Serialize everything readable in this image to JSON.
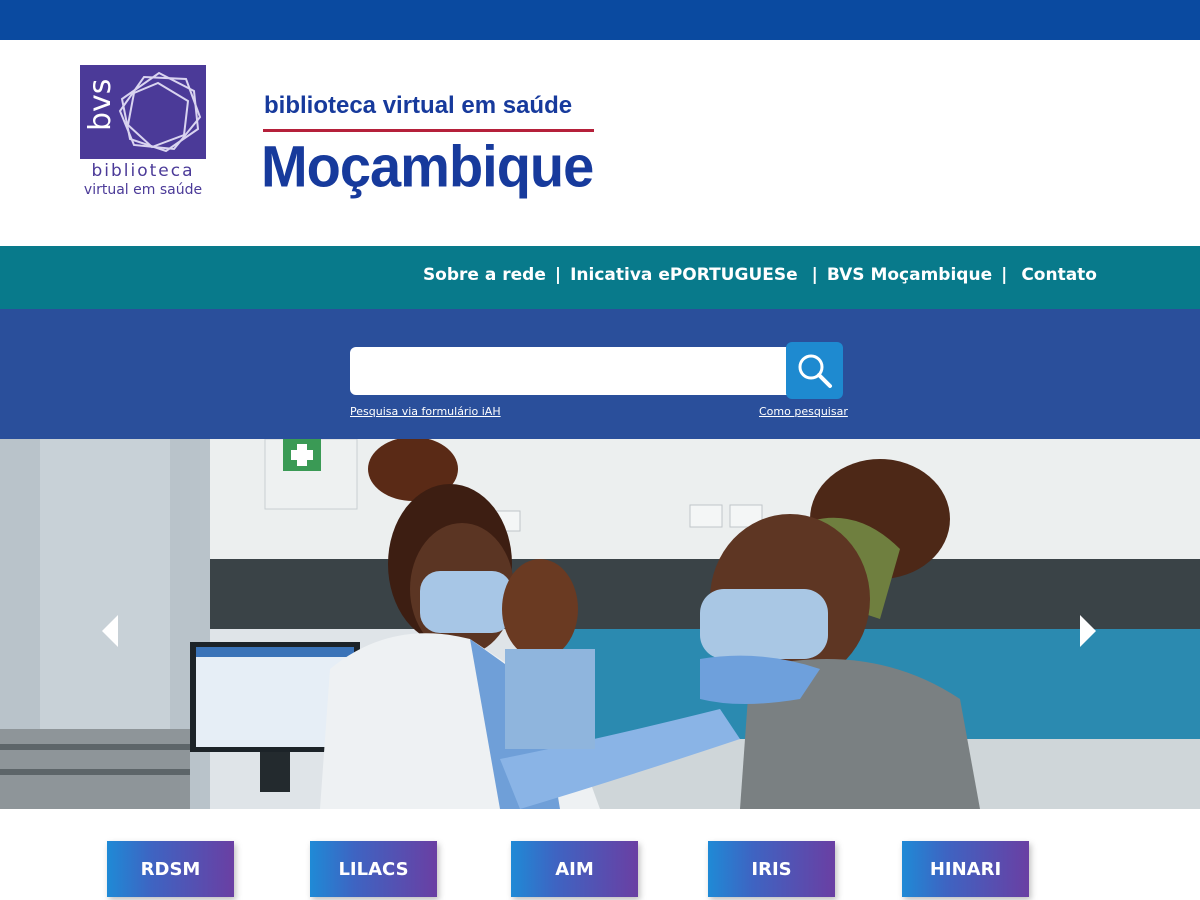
{
  "logo": {
    "abbr": "bvs",
    "line1": "biblioteca",
    "line2": "virtual em saúde"
  },
  "title": {
    "subtitle": "biblioteca virtual em saúde",
    "main": "Moçambique"
  },
  "nav": {
    "items": [
      {
        "label": "Sobre a rede"
      },
      {
        "label": "Inicativa ePORTUGUESe"
      },
      {
        "label": "BVS Moçambique"
      },
      {
        "label": "Contato"
      }
    ],
    "separator": "|"
  },
  "search": {
    "value": "",
    "placeholder": "",
    "link_iah": "Pesquisa via formulário iAH",
    "link_how": "Como pesquisar",
    "icon": "search-icon"
  },
  "hero": {
    "prev_icon": "chevron-left-icon",
    "next_icon": "chevron-right-icon"
  },
  "cards": [
    {
      "label": "RDSM"
    },
    {
      "label": "LILACS"
    },
    {
      "label": "AIM"
    },
    {
      "label": "IRIS"
    },
    {
      "label": "HINARI"
    }
  ],
  "colors": {
    "topbar": "#0a4aa0",
    "nav": "#087a8b",
    "search_band": "#2a4f9b",
    "search_button": "#1e8ad0",
    "title": "#173a9c",
    "logo": "#4b3a98",
    "rule": "#b5203a"
  }
}
